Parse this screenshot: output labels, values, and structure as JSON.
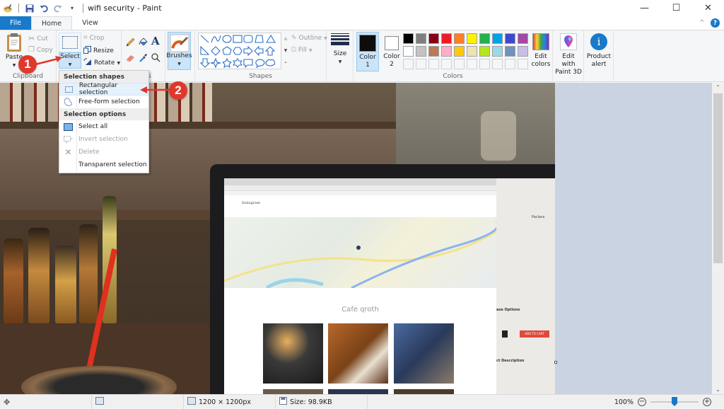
{
  "window": {
    "title": "wifi security - Paint",
    "controls": {
      "minimize": "—",
      "maximize": "☐",
      "close": "✕"
    }
  },
  "quick_access": {
    "icons": [
      "paint-app-icon",
      "save-icon",
      "undo-icon",
      "redo-icon",
      "customize-dropdown-icon"
    ]
  },
  "tabs": [
    {
      "label": "File",
      "active": false
    },
    {
      "label": "Home",
      "active": true
    },
    {
      "label": "View",
      "active": false
    }
  ],
  "ribbon_right": {
    "collapse": "^",
    "help": "?"
  },
  "ribbon": {
    "clipboard": {
      "label": "Clipboard",
      "paste": "Paste",
      "cut": "Cut",
      "copy": "Copy"
    },
    "image": {
      "select": "Select",
      "crop": "Crop",
      "resize": "Resize",
      "rotate": "Rotate"
    },
    "tools": {
      "label": "Tools"
    },
    "brushes": {
      "label": "Brushes"
    },
    "shapes": {
      "label": "Shapes",
      "outline": "Outline",
      "fill": "Fill"
    },
    "size": {
      "label": "Size"
    },
    "colors": {
      "label": "Colors",
      "color1": "Color 1",
      "color1_value": "#0d0d0d",
      "color2": "Color 2",
      "color2_value": "#ffffff",
      "palette_row1": [
        "#000000",
        "#7f7f7f",
        "#880015",
        "#ed1c24",
        "#ff7f27",
        "#fff200",
        "#22b14c",
        "#00a2e8",
        "#3f48cc",
        "#a349a4"
      ],
      "palette_row2": [
        "#ffffff",
        "#c3c3c3",
        "#b97a57",
        "#ffaec9",
        "#ffc90e",
        "#efe4b0",
        "#b5e61d",
        "#99d9ea",
        "#7092be",
        "#c8bfe7"
      ],
      "edit_colors": "Edit colors"
    },
    "paint3d": {
      "label": "Edit with Paint 3D"
    },
    "product_alert": {
      "label": "Product alert"
    }
  },
  "select_dropdown": {
    "section1": "Selection shapes",
    "rectangular": "Rectangular selection",
    "freeform": "Free-form selection",
    "section2": "Selection options",
    "select_all": "Select all",
    "invert": "Invert selection",
    "delete": "Delete",
    "transparent": "Transparent selection"
  },
  "annotations": {
    "step1": "1",
    "step2": "2",
    "color": "#e0382c"
  },
  "canvas": {
    "screen_heading": "Cafe qroth",
    "site_name": "Instagram",
    "side_title": "Paclara",
    "side_section1": "ase Options",
    "side_section2": "ct Description",
    "cart_label": "ADD TO CART"
  },
  "statusbar": {
    "dimensions": "1200 × 1200px",
    "size": "Size: 98.9KB",
    "zoom": "100%",
    "zoom_level_percent": 100
  }
}
